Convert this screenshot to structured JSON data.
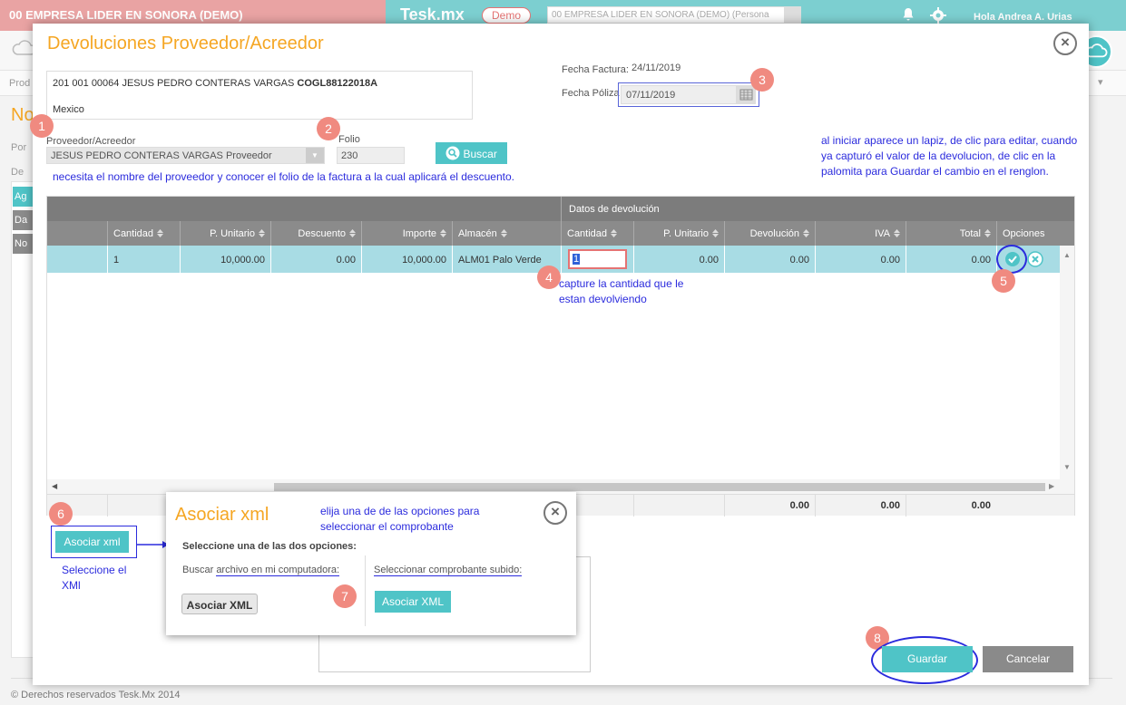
{
  "topbar": {
    "company": "00 EMPRESA LIDER EN SONORA (DEMO)",
    "brand": "Tesk.mx",
    "demo": "Demo",
    "company_select": "00 EMPRESA LIDER EN SONORA (DEMO) (Persona",
    "greeting": "Hola Andrea A. Urias",
    "colors": {
      "left": "#e9a3a3",
      "right": "#7ccfd0"
    }
  },
  "background": {
    "tab_text": "Prod",
    "title_fragment": "No",
    "por": "Por",
    "de": "De",
    "side_a": "Ag",
    "side_b": "Da",
    "side_c": "No",
    "footer": "© Derechos reservados Tesk.Mx 2014"
  },
  "modal": {
    "title": "Devoluciones Proveedor/Acreedor",
    "address_line": "201 001 00064 JESUS PEDRO CONTERAS VARGAS",
    "rfc": "COGL88122018A",
    "country": "Mexico",
    "fecha_factura_label": "Fecha Factura:",
    "fecha_factura": "24/11/2019",
    "fecha_poliza_label": "Fecha Póliza",
    "fecha_poliza": "07/11/2019",
    "proveedor_label": "Proveedor/Acreedor",
    "proveedor_value": "JESUS PEDRO CONTERAS VARGAS Proveedor",
    "folio_label": "Folio",
    "folio_value": "230",
    "buscar": "Buscar",
    "note_top": "al iniciar aparece un lapiz, de clic para editar, cuando ya capturó el valor de la devolucion, de clic en la palomita para Guardar el cambio en el renglon.",
    "note_proveedor": "necesita el nombre del proveedor y conocer el folio de la factura a la cual aplicará el descuento.",
    "note_cantidad": "capture la cantidad que le estan devolviendo",
    "note_xml": "Seleccione el XMl",
    "guardar": "Guardar",
    "cancelar": "Cancelar",
    "asociar_xml_btn": "Asociar xml",
    "badges": [
      "1",
      "2",
      "3",
      "4",
      "5",
      "6",
      "7",
      "8"
    ]
  },
  "grid": {
    "group_header": "Datos de devolución",
    "columns": [
      "Cantidad",
      "P. Unitario",
      "Descuento",
      "Importe",
      "Almacén",
      "Cantidad",
      "P. Unitario",
      "Devolución",
      "IVA",
      "Total",
      "Opciones"
    ],
    "row": {
      "cantidad": "1",
      "p_unitario": "10,000.00",
      "descuento": "0.00",
      "importe": "10,000.00",
      "almacen": "ALM01 Palo Verde",
      "dev_cantidad": "1",
      "dev_p_unitario": "0.00",
      "devolucion": "0.00",
      "iva": "0.00",
      "total": "0.00"
    },
    "totals": {
      "devolucion": "0.00",
      "iva": "0.00",
      "total": "0.00"
    }
  },
  "popup": {
    "title": "Asociar xml",
    "note": "elija una de de las opciones para seleccionar el comprobante",
    "subtitle": "Seleccione una de las dos opciones:",
    "buscar_label": "Buscar",
    "buscar_link": "archivo en mi computadora:",
    "seleccionar_link": "Seleccionar comprobante subido:",
    "btn_local": "Asociar XML",
    "btn_uploaded": "Asociar XML"
  },
  "colors": {
    "accent": "#4fc4c7",
    "title": "#f5a623",
    "note": "#2b2bdd",
    "badge": "#f08a80",
    "row": "#a8dce4"
  }
}
